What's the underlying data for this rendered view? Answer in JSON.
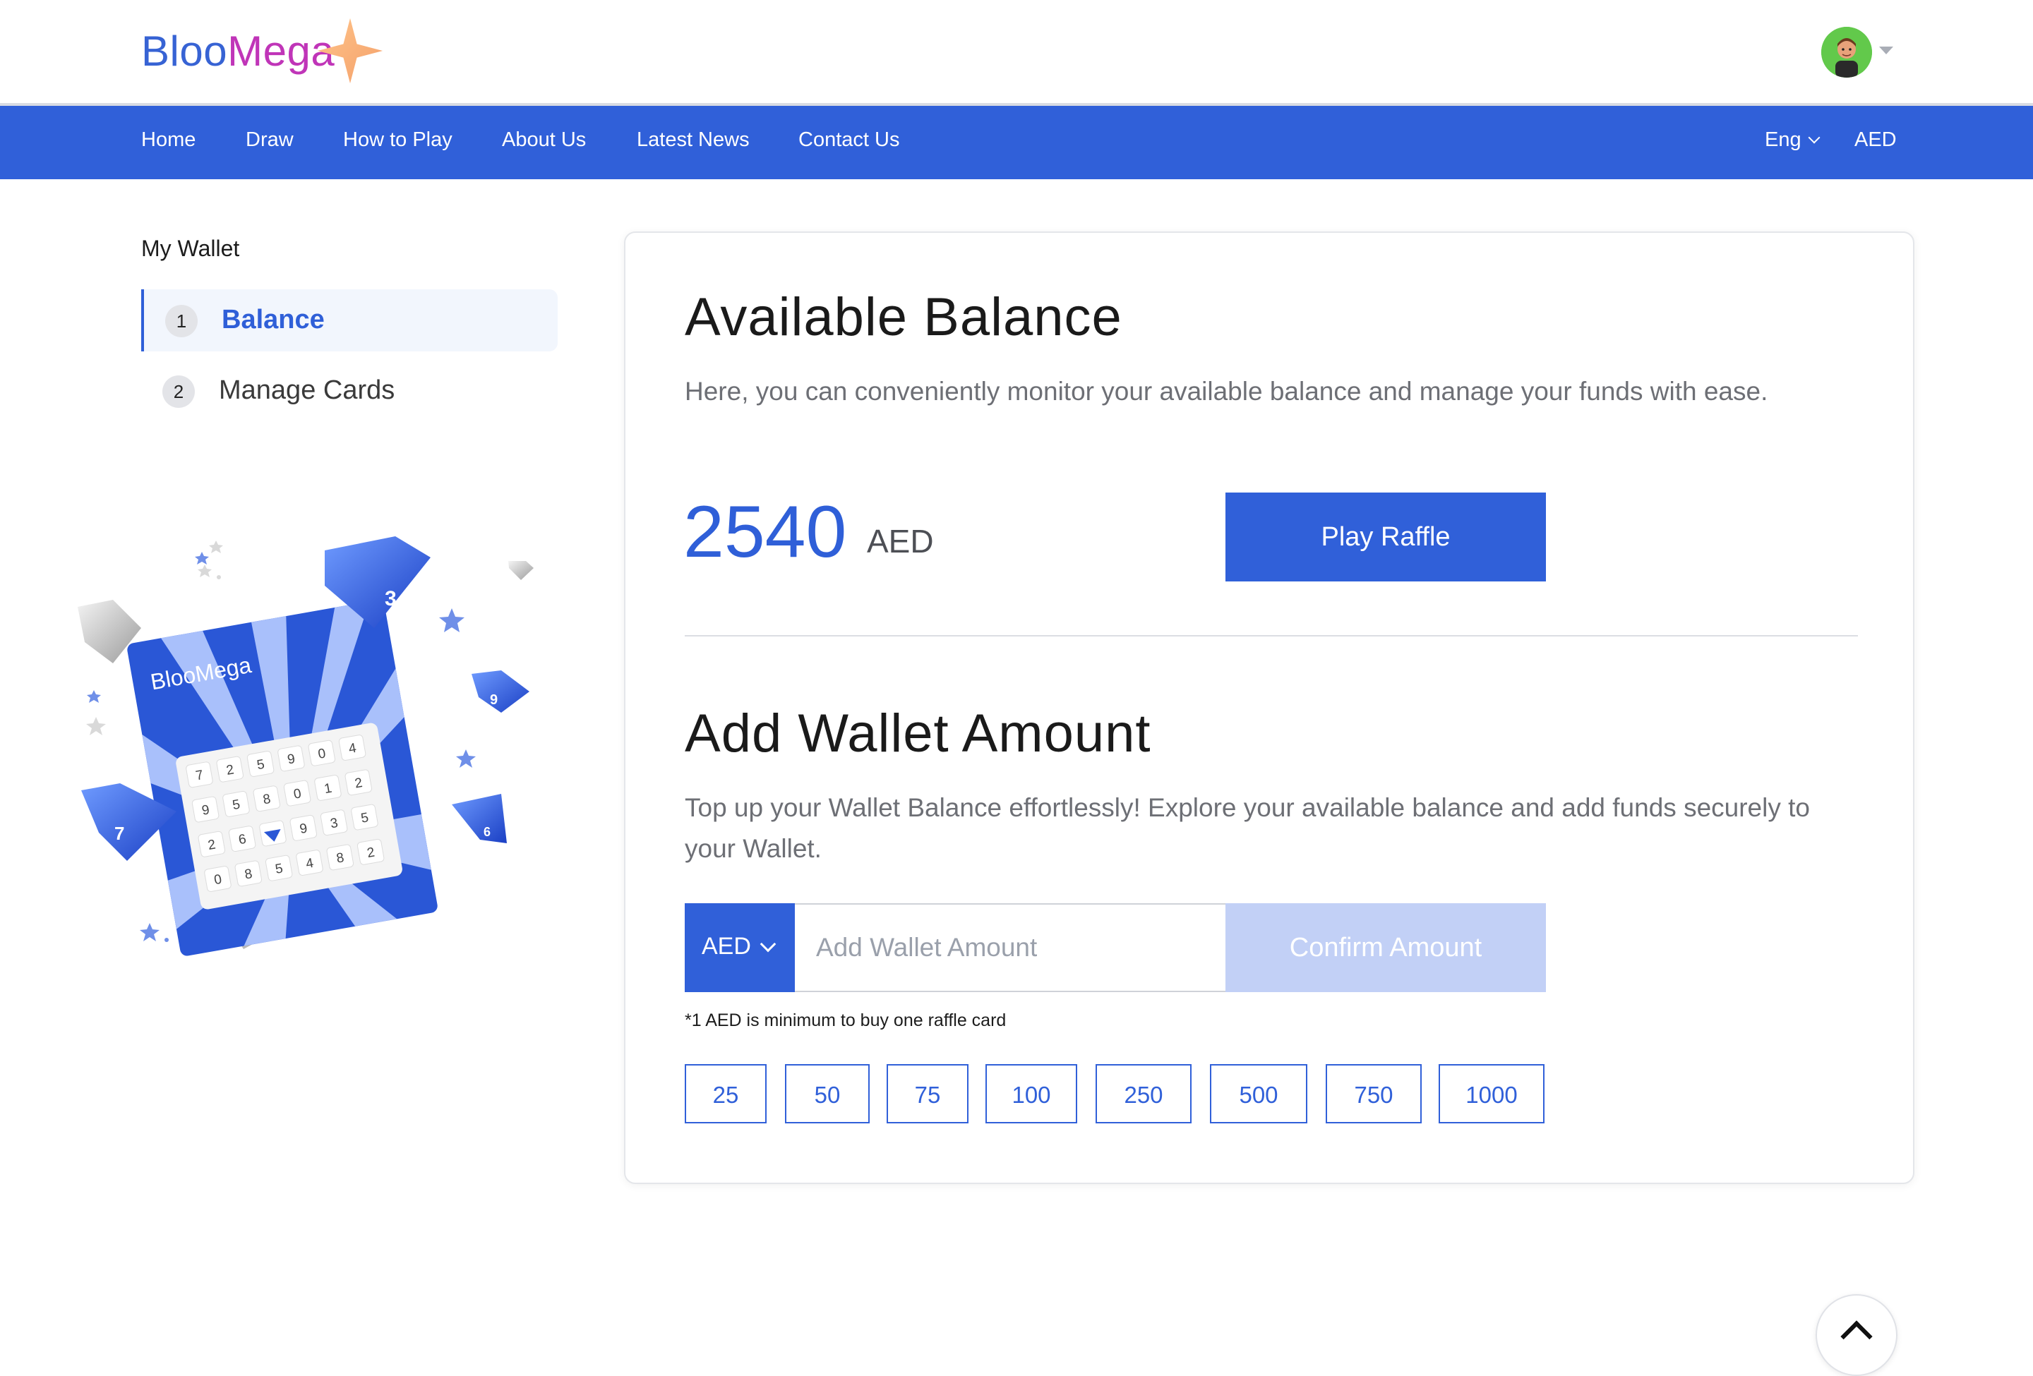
{
  "brand": {
    "logo_part1": "Bloo",
    "logo_part2": "Mega",
    "primary_color": "#3060d9",
    "accent_color": "#c035b8"
  },
  "header": {
    "avatar_alt": "User avatar"
  },
  "nav": {
    "items": [
      "Home",
      "Draw",
      "How to Play",
      "About Us",
      "Latest News",
      "Contact Us"
    ],
    "language": "Eng",
    "currency": "AED"
  },
  "sidebar": {
    "title": "My Wallet",
    "items": [
      {
        "num": "1",
        "label": "Balance",
        "active": true
      },
      {
        "num": "2",
        "label": "Manage Cards",
        "active": false
      }
    ]
  },
  "illustration": {
    "card_logo": "BlooMega",
    "gem_numbers": [
      "3",
      "9",
      "7",
      "6"
    ],
    "grid": [
      [
        "7",
        "2",
        "5",
        "9",
        "0",
        "4"
      ],
      [
        "9",
        "5",
        "8",
        "0",
        "1",
        "2"
      ],
      [
        "2",
        "6",
        "",
        "9",
        "3",
        "5"
      ],
      [
        "0",
        "8",
        "5",
        "4",
        "8",
        "2"
      ]
    ]
  },
  "balance": {
    "title": "Available Balance",
    "description": "Here, you can conveniently monitor your available balance and manage your funds with ease.",
    "amount": "2540",
    "currency": "AED",
    "play_button": "Play Raffle"
  },
  "wallet": {
    "title": "Add Wallet Amount",
    "description": "Top up your Wallet Balance effortlessly! Explore your available balance and add funds securely to your Wallet.",
    "currency": "AED",
    "input_placeholder": "Add Wallet Amount",
    "confirm_button": "Confirm Amount",
    "note": "*1 AED is minimum to buy one raffle card",
    "quick_amounts": [
      "25",
      "50",
      "75",
      "100",
      "250",
      "500",
      "750",
      "1000"
    ]
  }
}
